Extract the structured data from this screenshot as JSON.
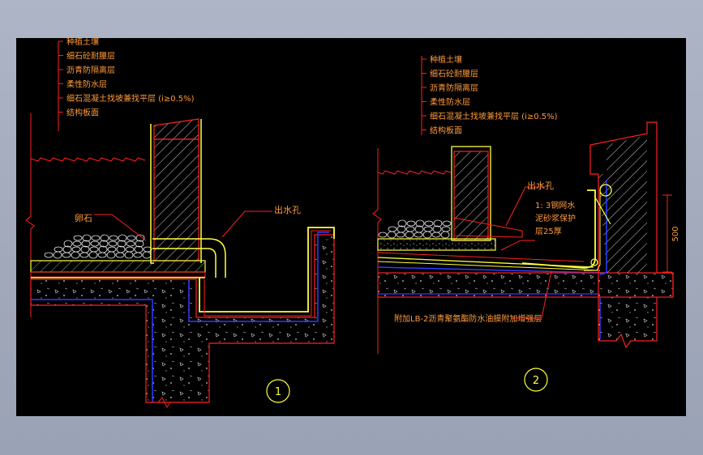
{
  "colors": {
    "background": "#000000",
    "frame": "#a1a9bb",
    "red": "#ff2020",
    "yellow": "#ffff40",
    "blue": "#2f3dff",
    "white": "#e8e8e8",
    "green": "#7fd07f",
    "label": "#ff9a3a"
  },
  "detail1": {
    "layers": [
      "种植土壤",
      "细石砼耐腰层",
      "沥青防隔离层",
      "柔性防水层",
      "细石混凝土找坡兼找平层 (i≥0.5%)",
      "结构板面"
    ],
    "gravel_label": "卵石",
    "outlet_label": "出水孔",
    "number": "1"
  },
  "detail2": {
    "layers": [
      "种植土壤",
      "细石砼耐腰层",
      "沥青防隔离层",
      "柔性防水层",
      "细石混凝土找坡兼找平层 (i≥0.5%)",
      "结构板面"
    ],
    "outlet_label": "出水孔",
    "mortar_note": [
      "1: 3钢网水",
      "泥砂浆保护",
      "层25厚"
    ],
    "bottom_note": "附加LB-2沥青聚氨酯防水油膜附加增强层",
    "dimension": "500",
    "number": "2"
  }
}
